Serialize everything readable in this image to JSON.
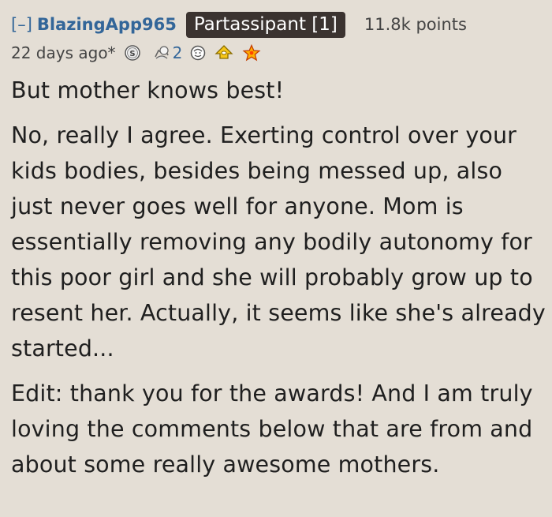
{
  "comment": {
    "collapse_label": "[–]",
    "author": "BlazingApp965",
    "flair": "Partassipant [1]",
    "score": "11.8k points",
    "time": "22 days ago*",
    "awards": [
      {
        "icon": "silver-award-icon",
        "count": ""
      },
      {
        "icon": "helpful-award-icon",
        "count": "2"
      },
      {
        "icon": "wholesome-award-icon",
        "count": ""
      },
      {
        "icon": "rocket-award-icon",
        "count": ""
      },
      {
        "icon": "star-award-icon",
        "count": ""
      }
    ],
    "paragraphs": [
      "But mother knows best!",
      "No, really I agree. Exerting control over your kids bodies, besides being messed up, also just never goes well for anyone. Mom is essentially removing any bodily autonomy for this poor girl and she will probably grow up to resent her. Actually, it seems like she's already started...",
      "Edit: thank you for the awards! And I am truly loving the comments below that are from and about some really awesome mothers."
    ]
  },
  "colors": {
    "background": "#e4ded5",
    "link": "#336699",
    "flair_bg": "#3b3330",
    "text": "#1f1f1f"
  }
}
